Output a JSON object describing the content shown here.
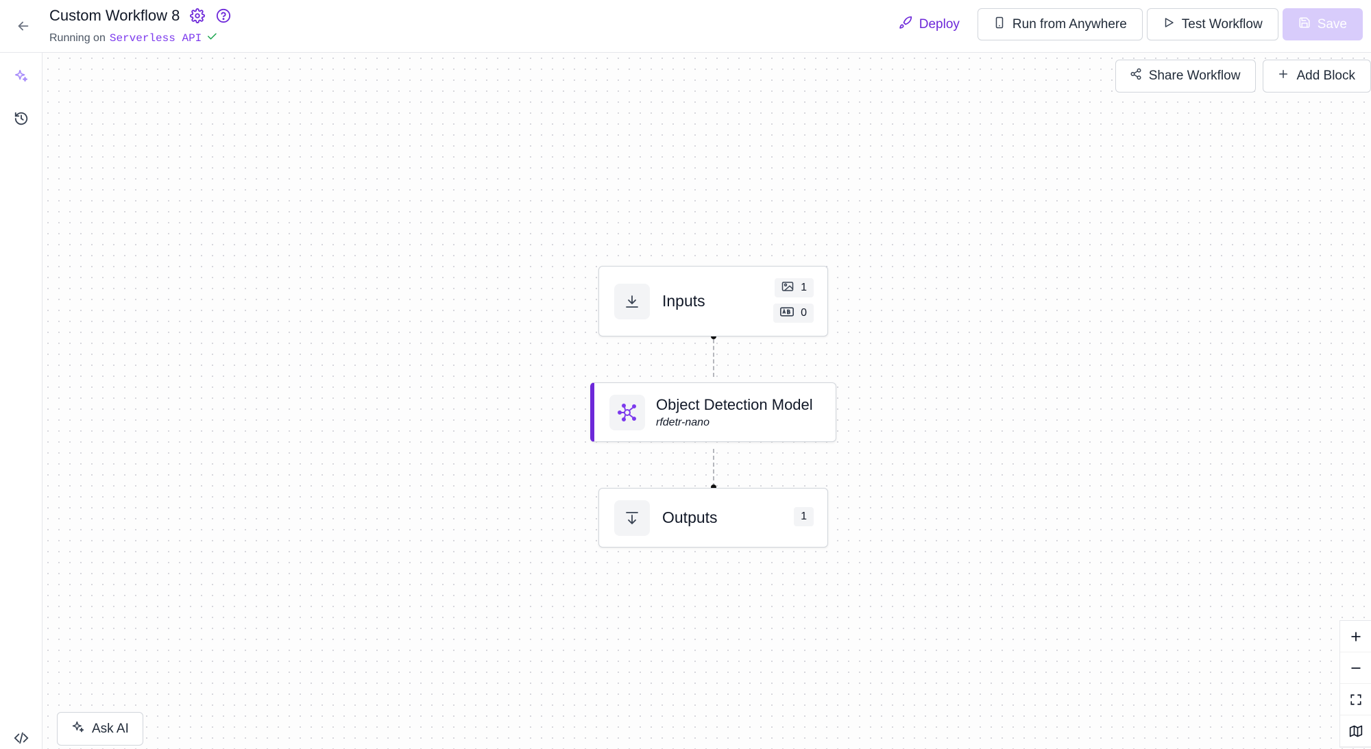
{
  "header": {
    "title": "Custom Workflow 8",
    "running_prefix": "Running on",
    "running_target": "Serverless API"
  },
  "actions": {
    "deploy": "Deploy",
    "run_anywhere": "Run from Anywhere",
    "test": "Test Workflow",
    "save": "Save"
  },
  "canvas_actions": {
    "share": "Share Workflow",
    "add_block": "Add Block"
  },
  "nodes": {
    "inputs": {
      "label": "Inputs",
      "image_count": "1",
      "param_count": "0"
    },
    "model": {
      "title": "Object Detection Model",
      "subtitle": "rfdetr-nano"
    },
    "outputs": {
      "label": "Outputs",
      "count": "1"
    }
  },
  "ask_ai": "Ask AI",
  "colors": {
    "accent": "#6d28d9",
    "save_disabled": "#d8ccfb",
    "success": "#16a34a"
  }
}
